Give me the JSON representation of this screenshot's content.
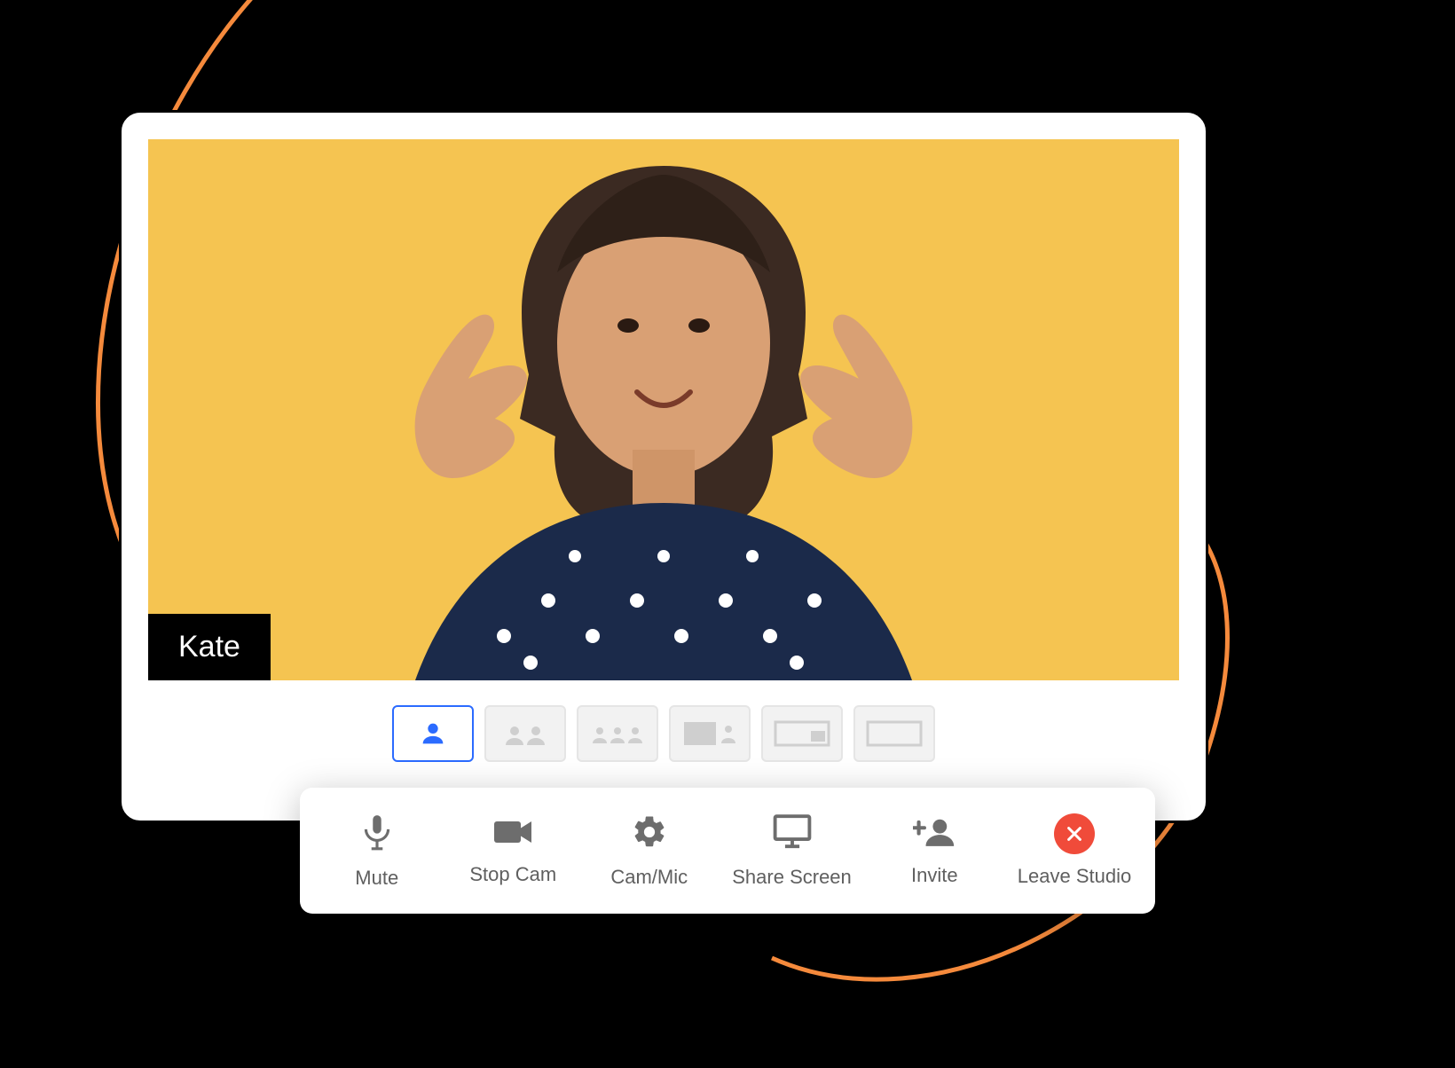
{
  "participant": {
    "name": "Kate"
  },
  "feed": {
    "background": "#F5C451"
  },
  "layouts": {
    "options": [
      "single",
      "two",
      "three-row",
      "side-main",
      "wide-main",
      "blank"
    ],
    "active_index": 0
  },
  "toolbar": {
    "mute": {
      "label": "Mute",
      "icon": "microphone-icon"
    },
    "cam": {
      "label": "Stop Cam",
      "icon": "camera-icon"
    },
    "settings": {
      "label": "Cam/Mic",
      "icon": "gear-icon"
    },
    "share": {
      "label": "Share Screen",
      "icon": "monitor-icon"
    },
    "invite": {
      "label": "Invite",
      "icon": "add-user-icon"
    },
    "leave": {
      "label": "Leave Studio",
      "icon": "close-icon",
      "color": "#F04B3A"
    }
  },
  "accent_color": "#2B6BFF",
  "squiggle_color": "#F58A3C"
}
